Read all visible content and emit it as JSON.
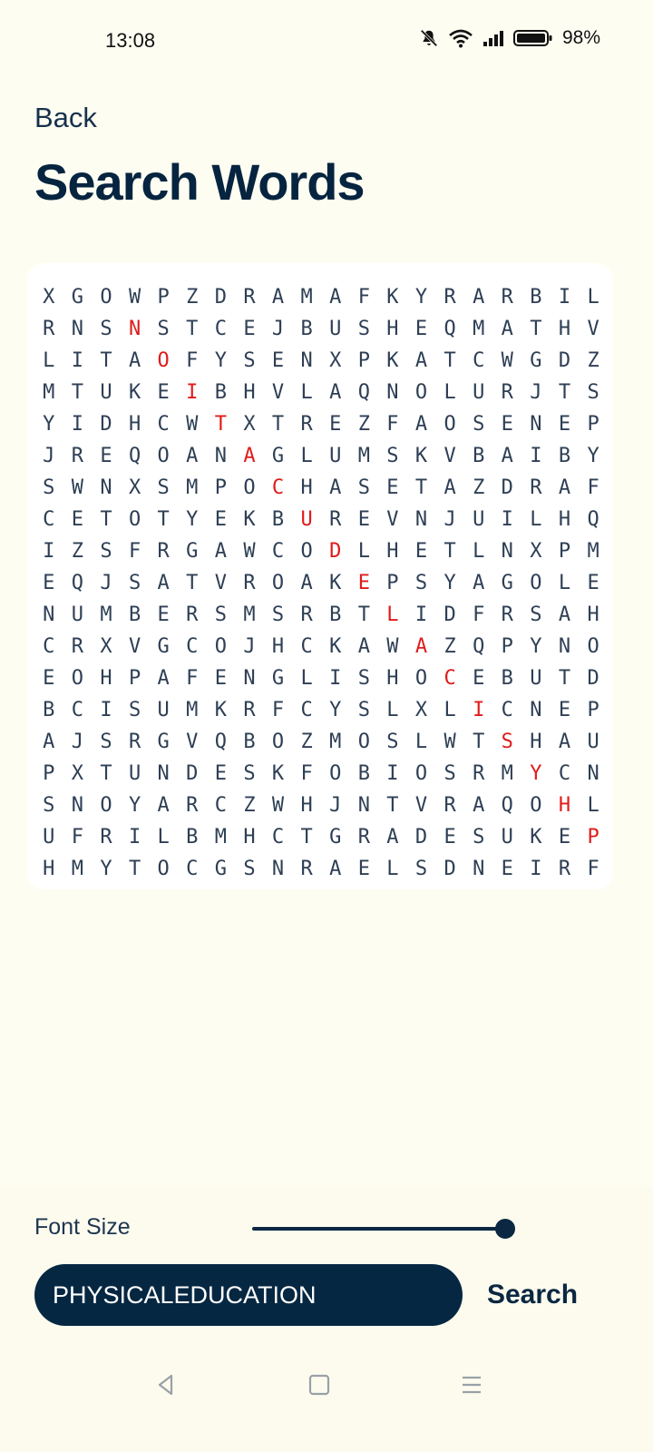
{
  "status_bar": {
    "time": "13:08",
    "battery": "98%",
    "icons": [
      "mute-icon",
      "wifi-icon",
      "signal-icon",
      "battery-icon"
    ]
  },
  "header": {
    "back_label": "Back",
    "title": "Search Words"
  },
  "puzzle": {
    "rows": [
      "XGOWPZDRAMAFKYRARBIL",
      "RNSNSTCEJBUSHEQMATHV",
      "LITAOFYSENXPKATCWGDZ",
      "MTUKEIBHVLAQNOLURJTS",
      "YIDHCWTXTREZFAOSENEP",
      "JREQOANAGLUMSKVBAIBY",
      "SWNXSMPOCHASETAZDRAF",
      "CETOTYEKBUREVNJUILHQ",
      "IZSFRGAWCODLHETLNXPM",
      "EQJSATVROAKEPSYAGOLE",
      "NUMBERSMSRBTLIDFRSAH",
      "CRXVGCOJHCKAWAZQPYNO",
      "EOHPAFENGLISHOCEBUTD",
      "BCISUMKRFCYSLXLICNEP",
      "AJSRGVQBOZMOSLWTSHAU",
      "PXTUNDESKFOBIOSRMYCN",
      "SNOYARCZWHJNTVRAQOHL",
      "UFRILBMHCTGRADESUKEP",
      "HMYTOCGSNRAELSDNEIRF"
    ],
    "highlighted": [
      [
        1,
        3
      ],
      [
        2,
        4
      ],
      [
        3,
        5
      ],
      [
        4,
        6
      ],
      [
        5,
        7
      ],
      [
        6,
        8
      ],
      [
        7,
        9
      ],
      [
        8,
        10
      ],
      [
        9,
        11
      ],
      [
        10,
        12
      ],
      [
        11,
        13
      ],
      [
        12,
        14
      ],
      [
        13,
        15
      ],
      [
        14,
        16
      ],
      [
        15,
        17
      ],
      [
        16,
        18
      ],
      [
        17,
        19
      ]
    ],
    "highlight_color": "#e01b1b",
    "letter_color": "#2e3f55"
  },
  "controls": {
    "font_size_label": "Font Size",
    "font_size_value": 1.0,
    "search_value": "PHYSICALEDUCATION",
    "search_button_label": "Search"
  },
  "colors": {
    "background": "#fefdf1",
    "primary": "#062742"
  },
  "nav": {
    "icons": [
      "back-triangle-icon",
      "home-square-icon",
      "menu-lines-icon"
    ]
  }
}
